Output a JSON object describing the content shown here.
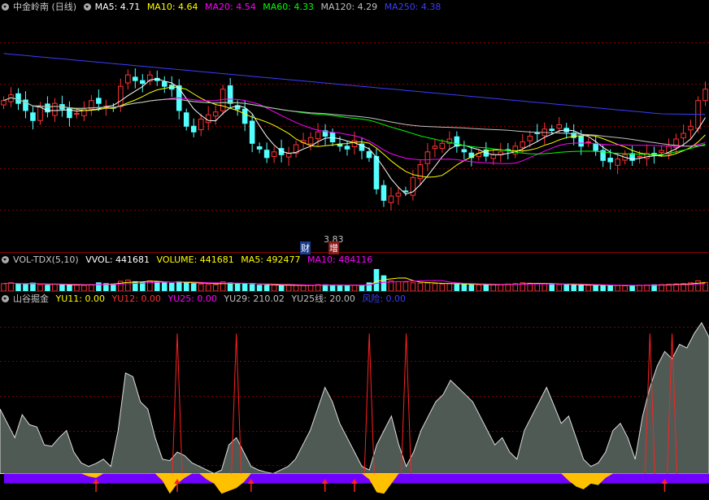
{
  "price_legend": {
    "title": "中金岭南 (日线)",
    "ma5": "MA5: 4.71",
    "ma10": "MA10: 4.64",
    "ma20": "MA20: 4.54",
    "ma60": "MA60: 4.33",
    "ma120": "MA120: 4.29",
    "ma250": "MA250: 4.38"
  },
  "price_annotations": {
    "low_label": "3.83",
    "marker_cai": "财",
    "marker_zeng": "增"
  },
  "vol_legend": {
    "title": "VOL-TDX(5,10)",
    "vvol": "VVOL: 441681",
    "volume": "VOLUME: 441681",
    "ma5": "MA5: 492477",
    "ma10": "MA10: 484116"
  },
  "ind_legend": {
    "title": "山谷掘金",
    "yu11": "YU11: 0.00",
    "yu12": "YU12: 0.00",
    "yu25": "YU25: 0.00",
    "yu29": "YU29: 210.02",
    "yu25line": "YU25线: 20.00",
    "fengxian": "风险: 0.00"
  },
  "colors": {
    "up": "#ff3232",
    "down": "#54ffff",
    "ma5": "#ffffff",
    "ma10": "#ffff00",
    "ma20": "#ff00ff",
    "ma60": "#00ff00",
    "ma120": "#c0c0c0",
    "ma250": "#3c3cff",
    "mountain": "#4f5a55",
    "valley": "#ffc000",
    "band": "#7000ff",
    "arrow": "#ff2020"
  },
  "chart_data": {
    "type": "candlestick",
    "y_range": [
      3.7,
      5.2
    ],
    "low_marker_value": 3.83,
    "closes": [
      4.62,
      4.66,
      4.6,
      4.55,
      4.48,
      4.58,
      4.54,
      4.6,
      4.56,
      4.5,
      4.53,
      4.56,
      4.62,
      4.6,
      4.58,
      4.57,
      4.72,
      4.8,
      4.76,
      4.74,
      4.8,
      4.76,
      4.72,
      4.7,
      4.55,
      4.44,
      4.4,
      4.49,
      4.52,
      4.54,
      4.7,
      4.6,
      4.56,
      4.46,
      4.32,
      4.28,
      4.22,
      4.26,
      4.24,
      4.25,
      4.31,
      4.34,
      4.36,
      4.4,
      4.37,
      4.33,
      4.3,
      4.28,
      4.34,
      4.27,
      4.22,
      4.0,
      3.92,
      3.95,
      3.97,
      3.98,
      4.08,
      4.17,
      4.26,
      4.3,
      4.32,
      4.35,
      4.3,
      4.26,
      4.22,
      4.25,
      4.23,
      4.24,
      4.26,
      4.27,
      4.3,
      4.33,
      4.37,
      4.39,
      4.42,
      4.41,
      4.45,
      4.4,
      4.36,
      4.3,
      4.33,
      4.27,
      4.2,
      4.19,
      4.21,
      4.24,
      4.2,
      4.23,
      4.25,
      4.24,
      4.27,
      4.3,
      4.35,
      4.39,
      4.44,
      4.62,
      4.7
    ],
    "volume_range": [
      0,
      1200000
    ],
    "volumes": [
      380000,
      420000,
      360000,
      340000,
      410000,
      330000,
      300000,
      350000,
      320000,
      310000,
      300000,
      290000,
      330000,
      420000,
      380000,
      360000,
      500000,
      560000,
      480000,
      450000,
      520000,
      470000,
      430000,
      400000,
      480000,
      450000,
      380000,
      360000,
      340000,
      330000,
      470000,
      420000,
      380000,
      360000,
      340000,
      300000,
      290000,
      310000,
      280000,
      300000,
      290000,
      280000,
      300000,
      330000,
      320000,
      300000,
      290000,
      280000,
      300000,
      290000,
      420000,
      1100000,
      780000,
      520000,
      480000,
      460000,
      420000,
      400000,
      410000,
      380000,
      360000,
      380000,
      350000,
      340000,
      330000,
      320000,
      310000,
      340000,
      330000,
      360000,
      380000,
      420000,
      400000,
      380000,
      360000,
      340000,
      330000,
      320000,
      300000,
      310000,
      290000,
      280000,
      300000,
      290000,
      280000,
      270000,
      290000,
      300000,
      310000,
      320000,
      330000,
      340000,
      360000,
      380000,
      420000,
      520000,
      441681
    ],
    "indicator": {
      "y_range": [
        -30,
        210
      ],
      "mountain": [
        90,
        70,
        50,
        82,
        68,
        65,
        40,
        38,
        50,
        60,
        30,
        15,
        10,
        14,
        20,
        10,
        60,
        140,
        135,
        100,
        90,
        50,
        20,
        18,
        30,
        25,
        15,
        10,
        5,
        0,
        5,
        40,
        50,
        30,
        10,
        5,
        2,
        0,
        5,
        10,
        20,
        40,
        60,
        90,
        120,
        100,
        70,
        50,
        30,
        10,
        5,
        40,
        60,
        80,
        40,
        10,
        30,
        60,
        80,
        100,
        110,
        130,
        120,
        110,
        100,
        80,
        60,
        40,
        50,
        30,
        20,
        60,
        80,
        100,
        120,
        95,
        70,
        80,
        50,
        20,
        10,
        15,
        30,
        60,
        70,
        50,
        20,
        80,
        120,
        150,
        170,
        160,
        180,
        175,
        195,
        210,
        190
      ],
      "valley": [
        0,
        0,
        0,
        0,
        0,
        0,
        0,
        0,
        0,
        0,
        0,
        0,
        -4,
        -6,
        0,
        0,
        0,
        0,
        0,
        0,
        0,
        0,
        -10,
        -28,
        -14,
        -6,
        0,
        0,
        -8,
        -14,
        -28,
        -24,
        -20,
        -12,
        0,
        0,
        0,
        0,
        0,
        0,
        0,
        0,
        0,
        0,
        0,
        0,
        0,
        0,
        0,
        0,
        -8,
        -26,
        -28,
        -14,
        0,
        0,
        0,
        0,
        0,
        0,
        0,
        0,
        0,
        0,
        0,
        0,
        0,
        0,
        0,
        0,
        0,
        0,
        0,
        0,
        0,
        0,
        0,
        -10,
        -18,
        -22,
        -14,
        -16,
        -6,
        0,
        0,
        0,
        0,
        0,
        0,
        0,
        0,
        0,
        0,
        0,
        0,
        0,
        0
      ],
      "spikes": [
        24,
        32,
        50,
        55,
        88,
        91
      ],
      "arrows": [
        13,
        24,
        34,
        44,
        48,
        90
      ]
    }
  }
}
